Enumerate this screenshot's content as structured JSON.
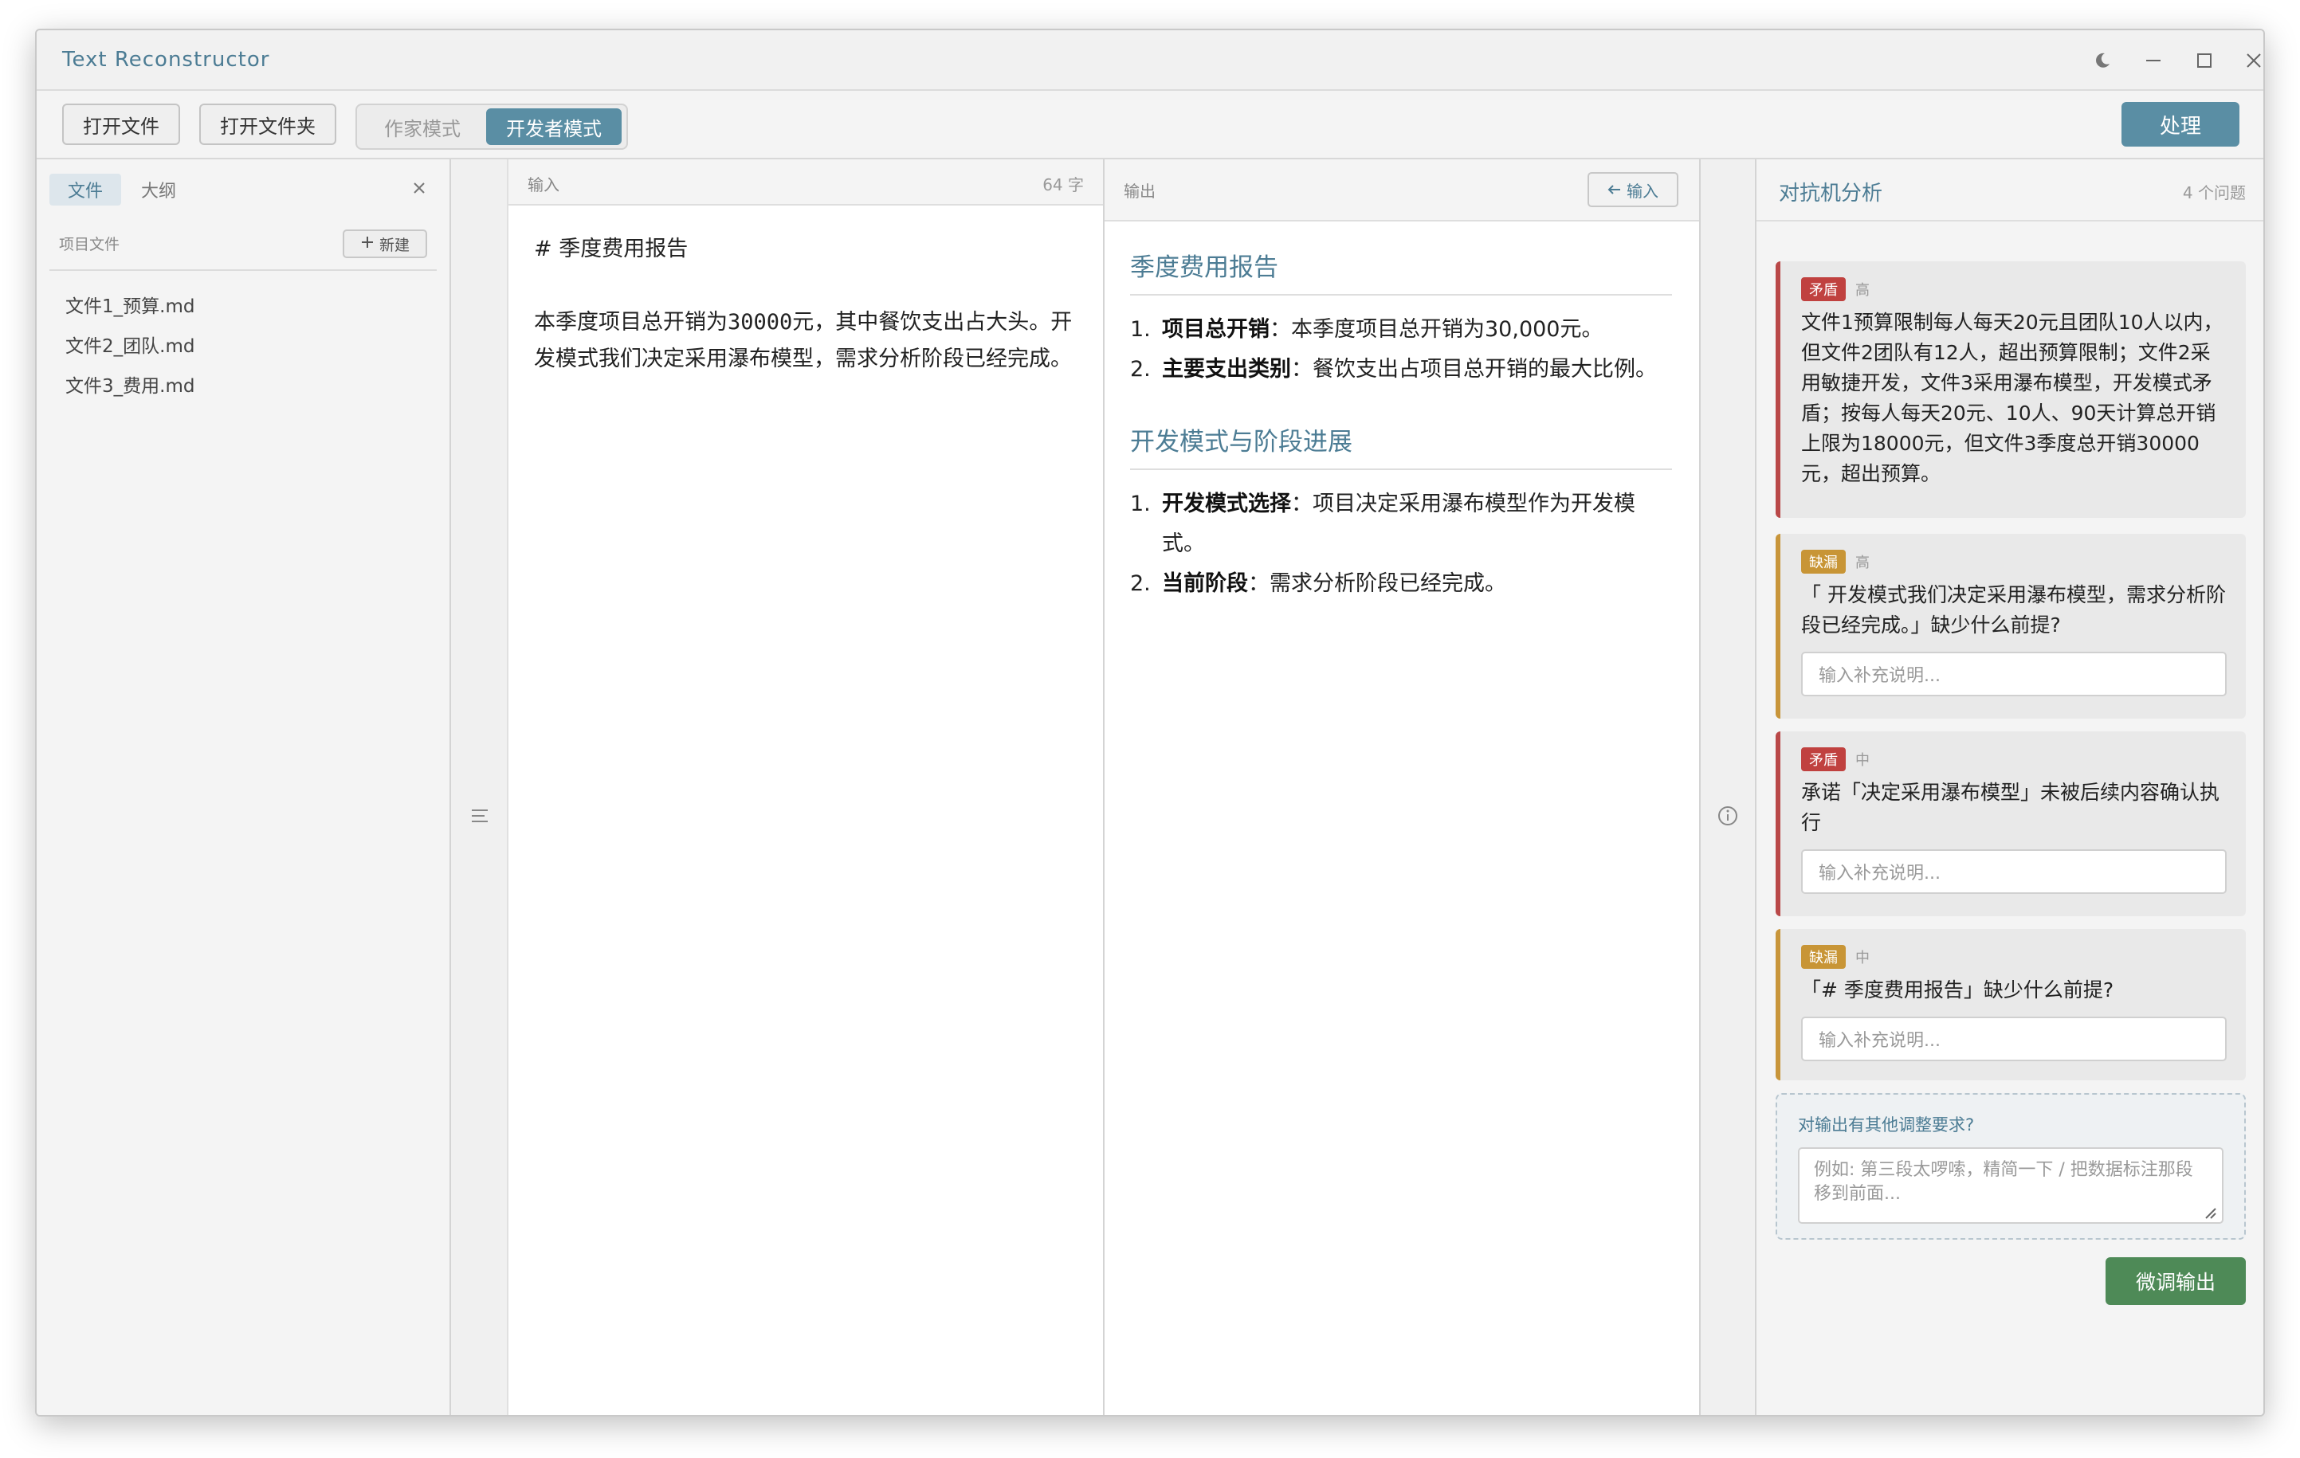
{
  "app": {
    "title": "Text Reconstructor"
  },
  "window_controls": {
    "theme": "moon-icon",
    "minimize": "minimize-icon",
    "maximize": "maximize-icon",
    "close": "close-icon"
  },
  "toolbar": {
    "open_file": "打开文件",
    "open_folder": "打开文件夹",
    "mode_writer": "作家模式",
    "mode_developer": "开发者模式",
    "process": "处理"
  },
  "sidebar": {
    "tabs": [
      {
        "label": "文件"
      },
      {
        "label": "大纲"
      }
    ],
    "section_title": "项目文件",
    "new_label": "新建",
    "files": [
      "文件1_预算.md",
      "文件2_团队.md",
      "文件3_费用.md"
    ]
  },
  "input": {
    "label": "输入",
    "count": "64 字",
    "heading": "# 季度费用报告",
    "body_before": "本季度项目总开销为",
    "body_number": "30000",
    "body_after": "元，其中餐饮支出占大头。开发模式我们决定采用瀑布模型，需求分析阶段已经完成。"
  },
  "output": {
    "label": "输出",
    "back_label": "输入",
    "sections": [
      {
        "heading": "季度费用报告",
        "items": [
          {
            "num": "1.",
            "key": "项目总开销",
            "text": "：本季度项目总开销为30,000元。"
          },
          {
            "num": "2.",
            "key": "主要支出类别",
            "text": "：餐饮支出占项目总开销的最大比例。"
          }
        ]
      },
      {
        "heading": "开发模式与阶段进展",
        "items": [
          {
            "num": "1.",
            "key": "开发模式选择",
            "text": "：项目决定采用瀑布模型作为开发模式。"
          },
          {
            "num": "2.",
            "key": "当前阶段",
            "text": "：需求分析阶段已经完成。"
          }
        ]
      }
    ]
  },
  "analysis": {
    "title": "对抗机分析",
    "count": "4 个问题",
    "issues": [
      {
        "tag": "矛盾",
        "level": "高",
        "text": "文件1预算限制每人每天20元且团队10人以内，但文件2团队有12人，超出预算限制；文件2采用敏捷开发，文件3采用瀑布模型，开发模式矛盾；按每人每天20元、10人、90天计算总开销上限为18000元，但文件3季度总开销30000元，超出预算。"
      },
      {
        "tag": "缺漏",
        "level": "高",
        "text": "「 开发模式我们决定采用瀑布模型，需求分析阶段已经完成。」缺少什么前提?",
        "placeholder": "输入补充说明..."
      },
      {
        "tag": "矛盾",
        "level": "中",
        "text": "承诺「决定采用瀑布模型」未被后续内容确认执行",
        "placeholder": "输入补充说明..."
      },
      {
        "tag": "缺漏",
        "level": "中",
        "text": "「# 季度费用报告」缺少什么前提?",
        "placeholder": "输入补充说明..."
      }
    ],
    "extra_label": "对输出有其他调整要求?",
    "extra_placeholder": "例如: 第三段太啰嗦，精简一下 / 把数据标注那段移到前面...",
    "fine_tune": "微调输出"
  },
  "colors": {
    "accent": "#5a8ea4",
    "contradiction": "#c0413f",
    "omission": "#c89536",
    "confirm": "#4e8a57"
  }
}
